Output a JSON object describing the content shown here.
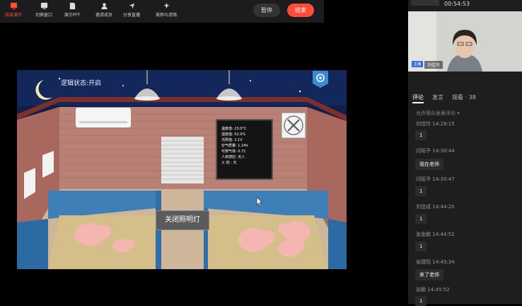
{
  "toolbar": {
    "items": [
      {
        "label": "结束演示",
        "icon": "end-share-icon"
      },
      {
        "label": "切换窗口",
        "icon": "switch-window-icon"
      },
      {
        "label": "演示PPT",
        "icon": "ppt-icon"
      },
      {
        "label": "邀请成员",
        "icon": "invite-members-icon"
      },
      {
        "label": "分享直播",
        "icon": "share-live-icon"
      },
      {
        "label": "美颜与滤镜",
        "icon": "beauty-filter-icon"
      }
    ],
    "pause_label": "暂停",
    "end_label": "结束"
  },
  "scene": {
    "caption": "逻辑状态:开启",
    "sensor_lines": [
      "温度值: 23.0°C",
      "湿度值: 52.0%",
      "光照值: 2.1V",
      "空气质量: 1.24V",
      "可燃气体: 0.71",
      "人体感应: 无人",
      "火 焰 : 无"
    ],
    "overlay_button": "关闭照明灯"
  },
  "live": {
    "timer": "00:54:53",
    "presenter_name": "刘佳玲",
    "host_tag": "主播"
  },
  "panel": {
    "tabs": [
      "评论",
      "发言",
      "观看 · 38"
    ],
    "filter_label": "允许观众发表评论",
    "messages": [
      {
        "name": "刘佳玲",
        "time": "14:28:15",
        "text": "1"
      },
      {
        "name": "闫昭予",
        "time": "14:30:44",
        "text": "我在老师"
      },
      {
        "name": "闫昭予",
        "time": "14:30:47",
        "text": "1"
      },
      {
        "name": "刘佳成",
        "time": "14:44:20",
        "text": "1"
      },
      {
        "name": "张金鹏",
        "time": "14:44:52",
        "text": "1"
      },
      {
        "name": "张建阳",
        "time": "14:45:34",
        "text": "来了老师"
      },
      {
        "name": "张鹏",
        "time": "14:45:52",
        "text": "1"
      }
    ]
  },
  "colors": {
    "accent_red": "#ff4c3b",
    "settings_blue": "#3a8bd5"
  }
}
